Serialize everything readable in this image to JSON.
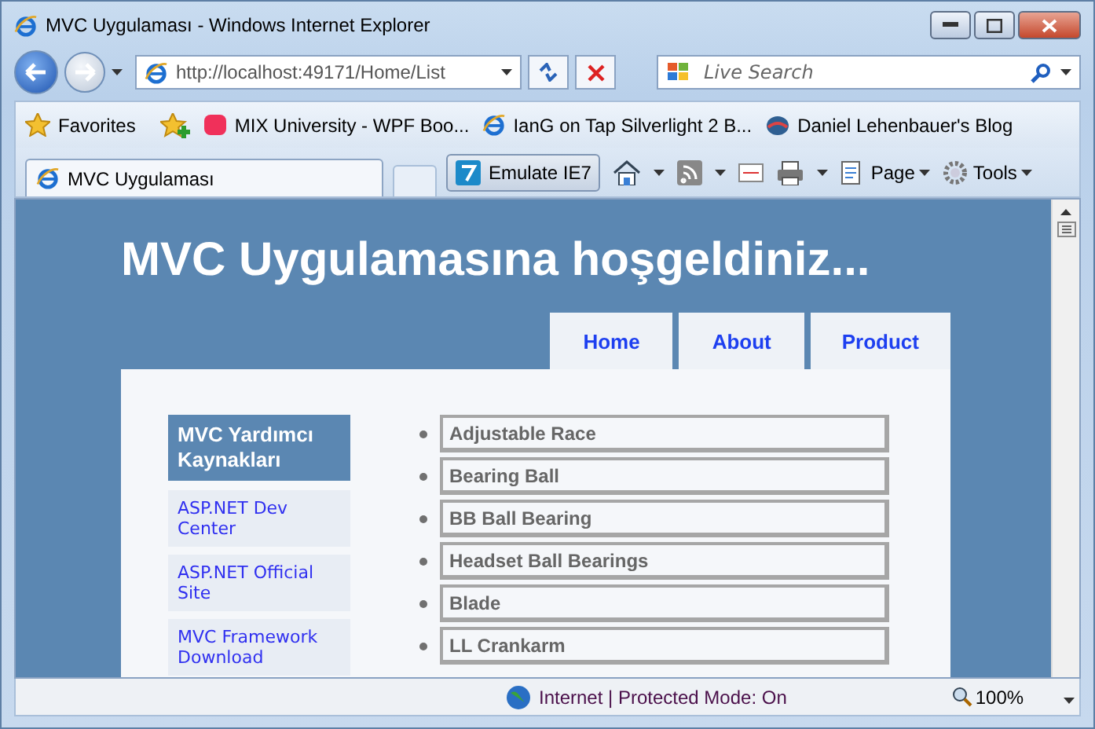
{
  "window": {
    "title": "MVC Uygulaması - Windows Internet Explorer"
  },
  "address_bar": {
    "url": "http://localhost:49171/Home/List"
  },
  "search": {
    "placeholder": "Live Search"
  },
  "favorites_bar": {
    "favorites": "Favorites",
    "links": [
      {
        "label": "MIX University - WPF Boo...",
        "kind": "mix"
      },
      {
        "label": "IanG on Tap Silverlight 2 B...",
        "kind": "ie"
      },
      {
        "label": "Daniel Lehenbauer's Blog",
        "kind": "blog"
      }
    ]
  },
  "tab": {
    "title": "MVC Uygulaması"
  },
  "command_bar": {
    "emulate": "Emulate IE7",
    "page": "Page",
    "tools": "Tools"
  },
  "page": {
    "heading": "MVC Uygulamasına hoşgeldiniz...",
    "menu": [
      "Home",
      "About",
      "Product"
    ],
    "sidebar": {
      "title": "MVC Yardımcı Kaynakları",
      "links": [
        "ASP.NET Dev Center",
        "ASP.NET Official Site",
        "MVC Framework Download"
      ]
    },
    "products": [
      "Adjustable Race",
      "Bearing Ball",
      "BB Ball Bearing",
      "Headset Ball Bearings",
      "Blade",
      "LL Crankarm"
    ]
  },
  "status_bar": {
    "zone": "Internet | Protected Mode: On",
    "zoom": "100%"
  }
}
